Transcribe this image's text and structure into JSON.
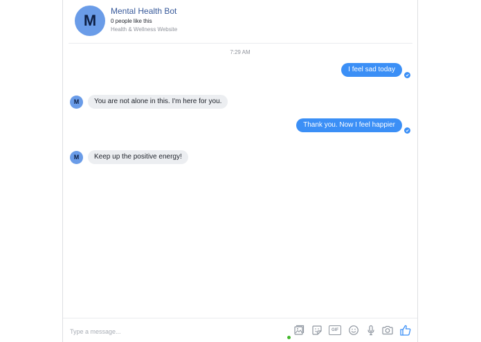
{
  "header": {
    "avatar_letter": "M",
    "page_name": "Mental Health Bot",
    "likes": "0 people like this",
    "category": "Health & Wellness Website"
  },
  "conversation": {
    "timestamp": "7:29 AM",
    "messages": [
      {
        "from": "user",
        "text": "I feel sad today"
      },
      {
        "from": "bot",
        "avatar_letter": "M",
        "text": "You are not alone in this. I'm here for you."
      },
      {
        "from": "user",
        "text": "Thank you.  Now I feel happier"
      },
      {
        "from": "bot",
        "avatar_letter": "M",
        "text": "Keep up the positive energy!"
      }
    ]
  },
  "composer": {
    "placeholder": "Type a message...",
    "gif_label": "GIF",
    "icons": [
      "photo-icon",
      "sticker-icon",
      "gif-icon",
      "emoji-icon",
      "microphone-icon",
      "camera-icon",
      "thumbs-up-icon"
    ]
  },
  "colors": {
    "accent": "#3b8ff6",
    "avatar_bg": "#6a9ce8",
    "bubble_in": "#eceef1",
    "link_name": "#365899",
    "icon_gray": "#8d949e"
  }
}
